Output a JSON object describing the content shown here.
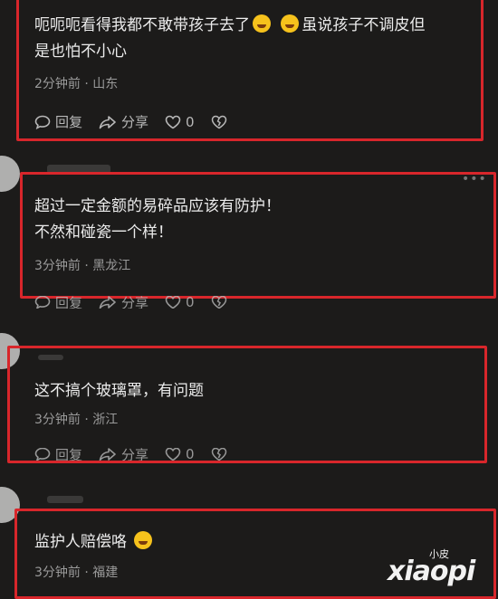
{
  "comments": [
    {
      "text_line1": "呃呃呃看得我都不敢带孩子去了",
      "text_line1b": "虽说孩子不调皮但",
      "text_line2": "是也怕不小心",
      "time": "2分钟前",
      "location": "山东"
    },
    {
      "text_line1": "超过一定金额的易碎品应该有防护！",
      "text_line2": "不然和碰瓷一个样！",
      "time": "3分钟前",
      "location": "黑龙江"
    },
    {
      "text_line1": "这不搞个玻璃罩，有问题",
      "time": "3分钟前",
      "location": "浙江"
    },
    {
      "text_line1": "监护人赔偿咯",
      "time": "3分钟前",
      "location": "福建"
    }
  ],
  "actions": {
    "reply": "回复",
    "share": "分享",
    "like_count": "0"
  },
  "separator": "·",
  "watermark": {
    "top": "小皮",
    "main": "xiaopi"
  },
  "colors": {
    "background": "#1c1b1a",
    "highlight_border": "#d8262b"
  },
  "icons": [
    "reply-icon",
    "share-icon",
    "heart-icon",
    "broken-heart-icon",
    "laughing-emoji-icon",
    "thinking-emoji-icon",
    "more-icon"
  ]
}
